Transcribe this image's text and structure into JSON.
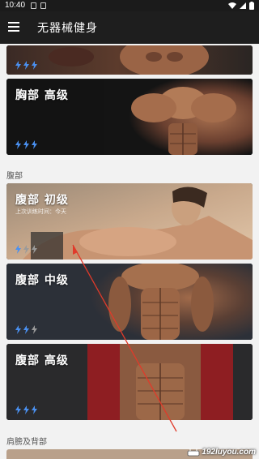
{
  "status_bar": {
    "time": "10:40"
  },
  "app_bar": {
    "title": "无器械健身"
  },
  "cards": [
    {
      "title": "胸部 高级",
      "level_bolts": 3
    }
  ],
  "sections": [
    {
      "header": "腹部",
      "cards": [
        {
          "title": "腹部 初级",
          "subtitle": "上次训练时间：今天",
          "level_bolts": 1
        },
        {
          "title": "腹部 中级",
          "level_bolts": 2
        },
        {
          "title": "腹部 高级",
          "level_bolts": 3
        }
      ]
    },
    {
      "header": "肩膀及背部"
    }
  ],
  "watermark": "192luyou.com",
  "colors": {
    "bolt_active": "#4a90f0",
    "bolt_inactive": "#9a9a9a",
    "annotation_arrow": "#e03a2a"
  }
}
